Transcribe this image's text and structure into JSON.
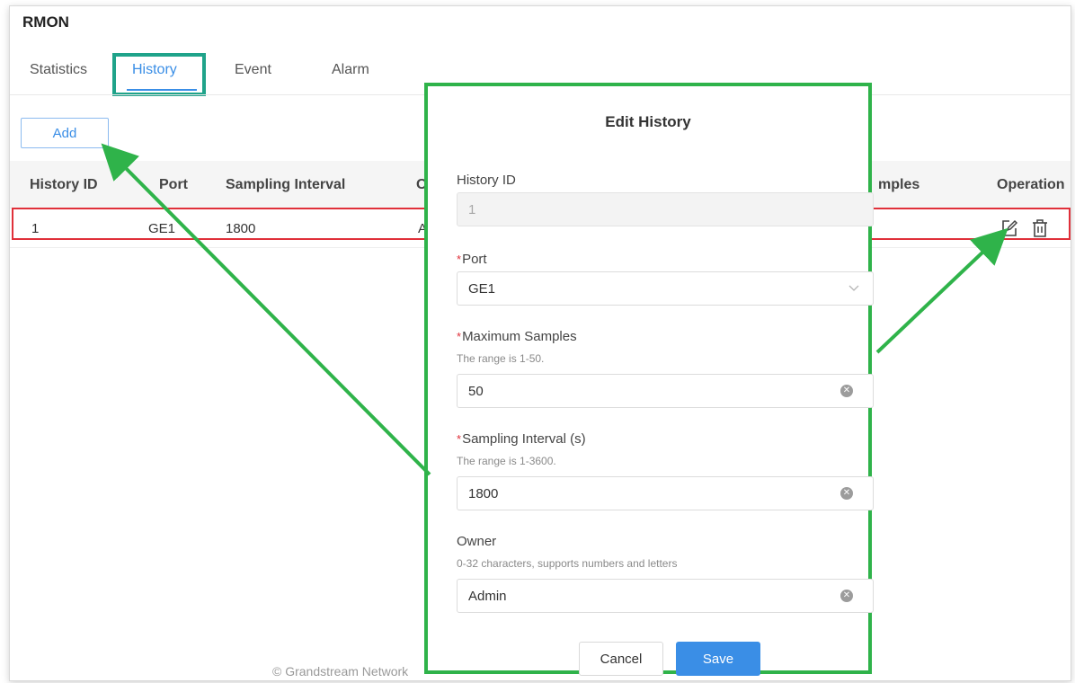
{
  "page": {
    "title": "RMON"
  },
  "tabs": [
    {
      "label": "Statistics"
    },
    {
      "label": "History"
    },
    {
      "label": "Event"
    },
    {
      "label": "Alarm"
    }
  ],
  "active_tab": "History",
  "toolbar": {
    "add_label": "Add"
  },
  "table": {
    "columns": [
      "History ID",
      "Port",
      "Sampling Interval",
      "O",
      "mples",
      "Operation"
    ],
    "rows": [
      {
        "history_id": "1",
        "port": "GE1",
        "sampling_interval": "1800",
        "owner_partial": "A"
      }
    ]
  },
  "footer": {
    "text": "© Grandstream Network"
  },
  "modal": {
    "title": "Edit History",
    "history_id": {
      "label": "History ID",
      "value": "1"
    },
    "port": {
      "label": "Port",
      "value": "GE1"
    },
    "max_samples": {
      "label": "Maximum Samples",
      "hint": "The range is 1-50.",
      "value": "50"
    },
    "sampling_interval": {
      "label": "Sampling Interval (s)",
      "hint": "The range is 1-3600.",
      "value": "1800"
    },
    "owner": {
      "label": "Owner",
      "hint": "0-32 characters, supports numbers and letters",
      "value": "Admin"
    },
    "required_mark": "*",
    "cancel_label": "Cancel",
    "save_label": "Save"
  },
  "colors": {
    "accent": "#3a8ee6",
    "highlight_teal": "#1fa38a",
    "highlight_red": "#e0303a",
    "highlight_green": "#2fb34a"
  },
  "icons": {
    "edit": "edit-icon",
    "delete": "trash-icon",
    "clear": "clear-icon",
    "dropdown": "chevron-down-icon"
  }
}
